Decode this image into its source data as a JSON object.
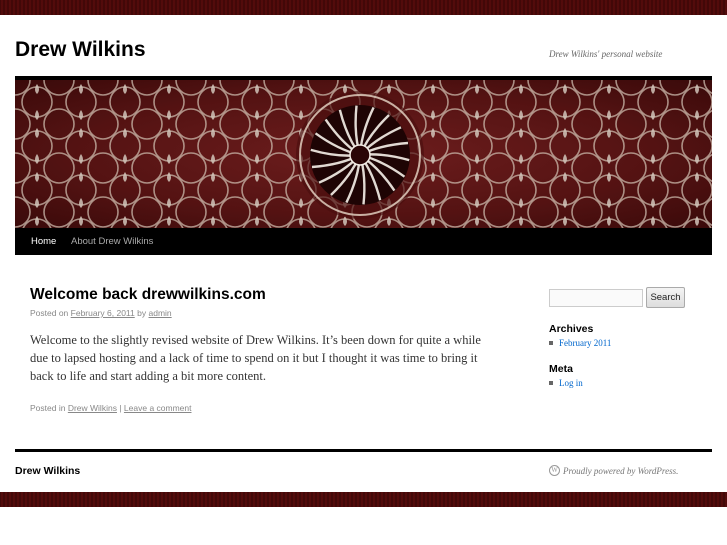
{
  "site": {
    "title": "Drew Wilkins",
    "description": "Drew Wilkins' personal website"
  },
  "nav": {
    "items": [
      {
        "label": "Home",
        "active": true
      },
      {
        "label": "About Drew Wilkins",
        "active": false
      }
    ]
  },
  "post": {
    "title": "Welcome back drewwilkins.com",
    "meta": {
      "posted_on": "Posted on",
      "date": "February 6, 2011",
      "by": "by",
      "author": "admin"
    },
    "content": "Welcome to the slightly revised website of Drew Wilkins.  It’s been down for quite a while due to lapsed hosting and a lack of time to spend on it but I thought it was time to bring it back to life and start adding a bit more content.",
    "utility": {
      "posted_in": "Posted in",
      "category": "Drew Wilkins",
      "separator": "|",
      "comment_link": "Leave a comment"
    }
  },
  "sidebar": {
    "search": {
      "placeholder": "",
      "button_label": "Search"
    },
    "archives": {
      "title": "Archives",
      "items": [
        "February 2011"
      ]
    },
    "meta": {
      "title": "Meta",
      "items": [
        "Log in"
      ]
    }
  },
  "footer": {
    "title": "Drew Wilkins",
    "credit": "Proudly powered by WordPress."
  },
  "colors": {
    "strip": "#3a0606",
    "link": "#0066cc",
    "banner_base": "#5a1414"
  },
  "icons": {
    "footer_icon": "wordpress-icon",
    "list_bullet": "square-bullet-icon"
  }
}
